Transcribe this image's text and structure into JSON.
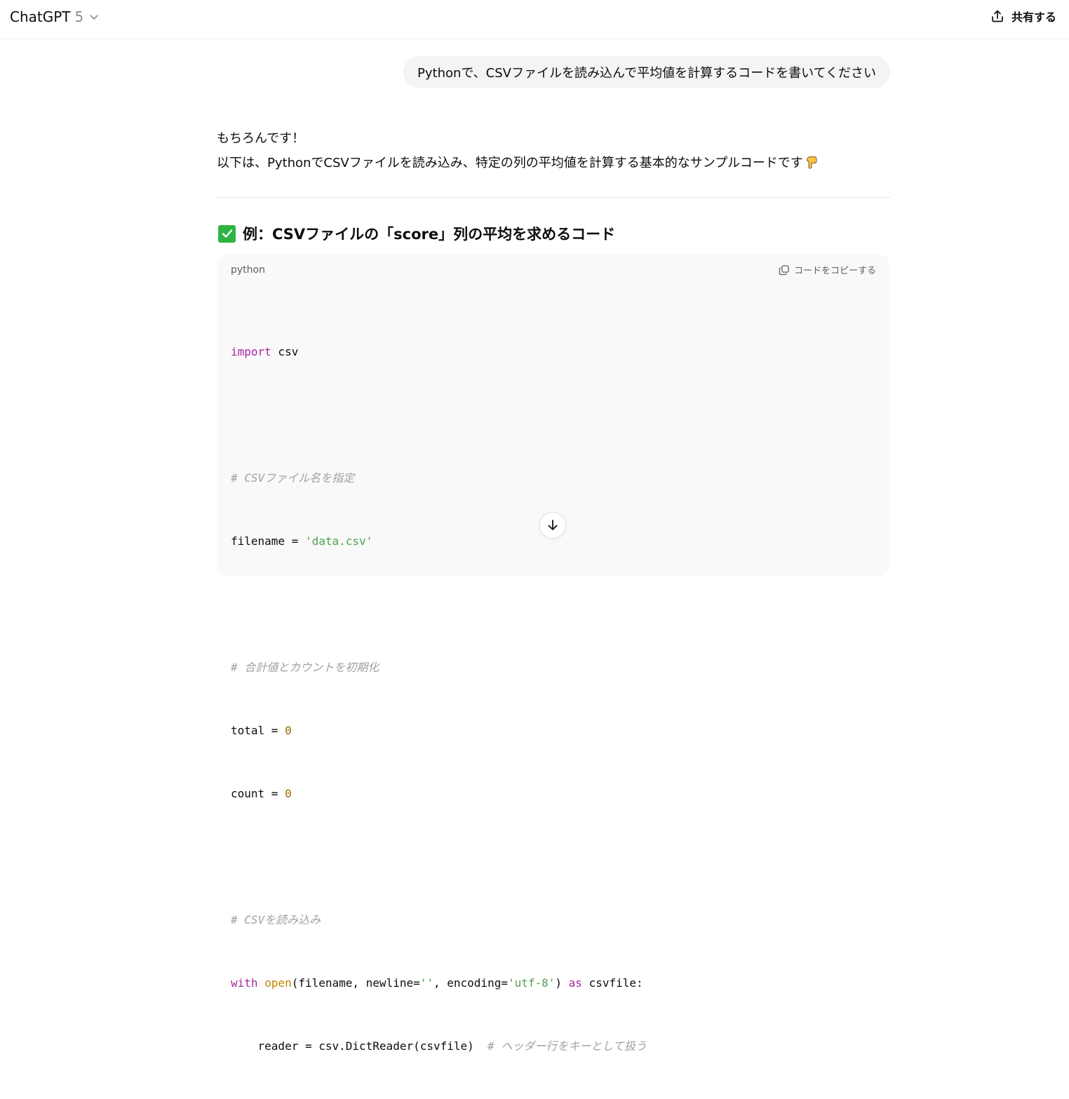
{
  "header": {
    "model_name": "ChatGPT",
    "model_version": "5",
    "share_label": "共有する"
  },
  "user_message": "Pythonで、CSVファイルを読み込んで平均値を計算するコードを書いてください",
  "assistant": {
    "line1": "もちろんです！",
    "line2": "以下は、PythonでCSVファイルを読み込み、特定の列の平均値を計算する基本的なサンプルコードです",
    "heading": "例：CSVファイルの「score」列の平均を求めるコード"
  },
  "code_block": {
    "language": "python",
    "copy_label": "コードをコピーする",
    "tokens": {
      "import_kw": "import",
      "import_rest": " csv",
      "c1": "# CSVファイル名を指定",
      "filename_lhs": "filename = ",
      "filename_str": "'data.csv'",
      "c2": "# 合計値とカウントを初期化",
      "total_lhs": "total = ",
      "total_val": "0",
      "count_lhs": "count = ",
      "count_val": "0",
      "c3": "# CSVを読み込み",
      "with_kw": "with",
      "open_fn": " open",
      "with_mid": "(filename, newline=",
      "empty_str": "''",
      "with_mid2": ", encoding=",
      "enc_str": "'utf-8'",
      "with_mid3": ") ",
      "as_kw": "as",
      "with_end": " csvfile:",
      "reader_line": "    reader = csv.DictReader(csvfile)  ",
      "c4": "# ヘッダー行をキーとして扱う"
    }
  },
  "colors": {
    "keyword": "#a626a4",
    "string": "#50a14f",
    "number": "#986801",
    "comment": "#a0a1a7",
    "check": "#2fb344"
  }
}
